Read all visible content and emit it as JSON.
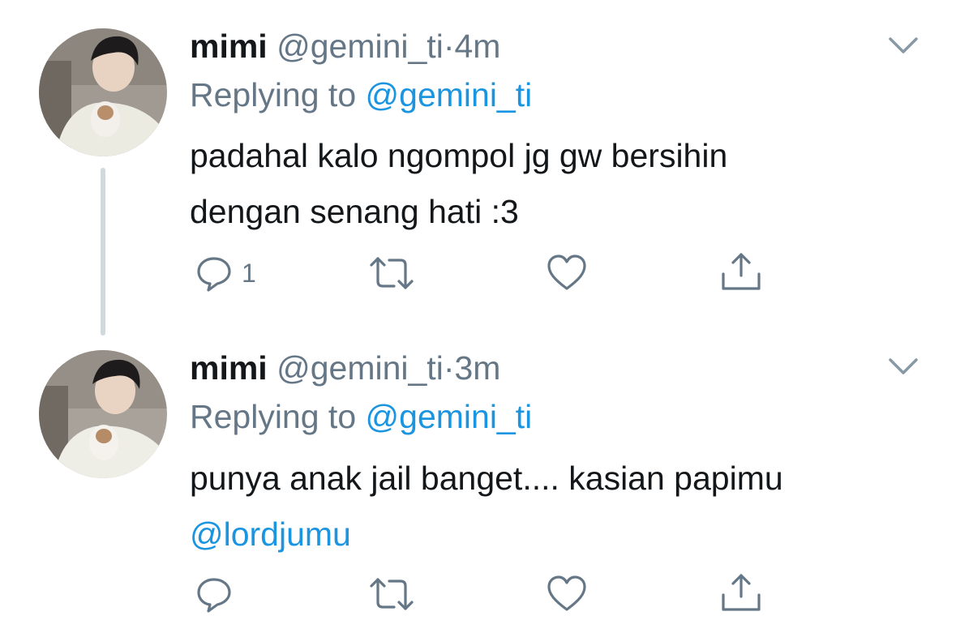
{
  "tweets": [
    {
      "name": "mimi",
      "handle": "@gemini_ti",
      "separator": "·",
      "time": "4m",
      "replying_prefix": "Replying to",
      "replying_to": "@gemini_ti",
      "body_line1": "padahal kalo ngompol jg gw bersihin",
      "body_line2": "dengan senang hati :3",
      "reply_count": "1"
    },
    {
      "name": "mimi",
      "handle": "@gemini_ti",
      "separator": "·",
      "time": "3m",
      "replying_prefix": "Replying to",
      "replying_to": "@gemini_ti",
      "body_line1": "punya anak jail banget.... kasian papimu",
      "body_mention": "@lordjumu",
      "reply_count": ""
    }
  ],
  "icons": {
    "reply": "reply-icon",
    "retweet": "retweet-icon",
    "like": "heart-icon",
    "share": "share-icon",
    "more": "chevron-down-icon"
  },
  "colors": {
    "text": "#14171a",
    "secondary": "#657786",
    "link": "#1b95e0",
    "thread_line": "#cfd9de"
  }
}
